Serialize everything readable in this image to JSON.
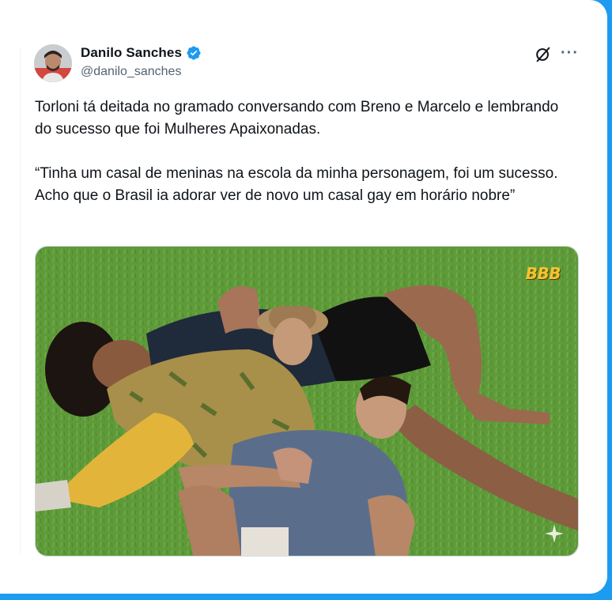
{
  "author": {
    "display_name": "Danilo Sanches",
    "handle": "@danilo_sanches",
    "verified": true,
    "avatar_icon": "user-avatar"
  },
  "actions": {
    "grok_icon": "grok-icon",
    "more_icon": "more-options-icon",
    "more_glyph": "···"
  },
  "tweet": {
    "paragraphs": [
      "Torloni tá deitada no gramado conversando com Breno e Marcelo e lembrando do sucesso que foi Mulheres Apaixonadas.",
      "“Tinha um casal de meninas na escola da minha personagem, foi um sucesso. Acho que o Brasil ia adorar ver de novo um casal gay em horário nobre”"
    ]
  },
  "media": {
    "watermark": "BBB",
    "overlay_icon": "sparkle-icon"
  },
  "colors": {
    "background_frame": "#1d9bf0",
    "text_primary": "#0f1419",
    "text_secondary": "#536471",
    "verified_badge": "#1d9bf0",
    "grass": "#5f9a3a"
  }
}
